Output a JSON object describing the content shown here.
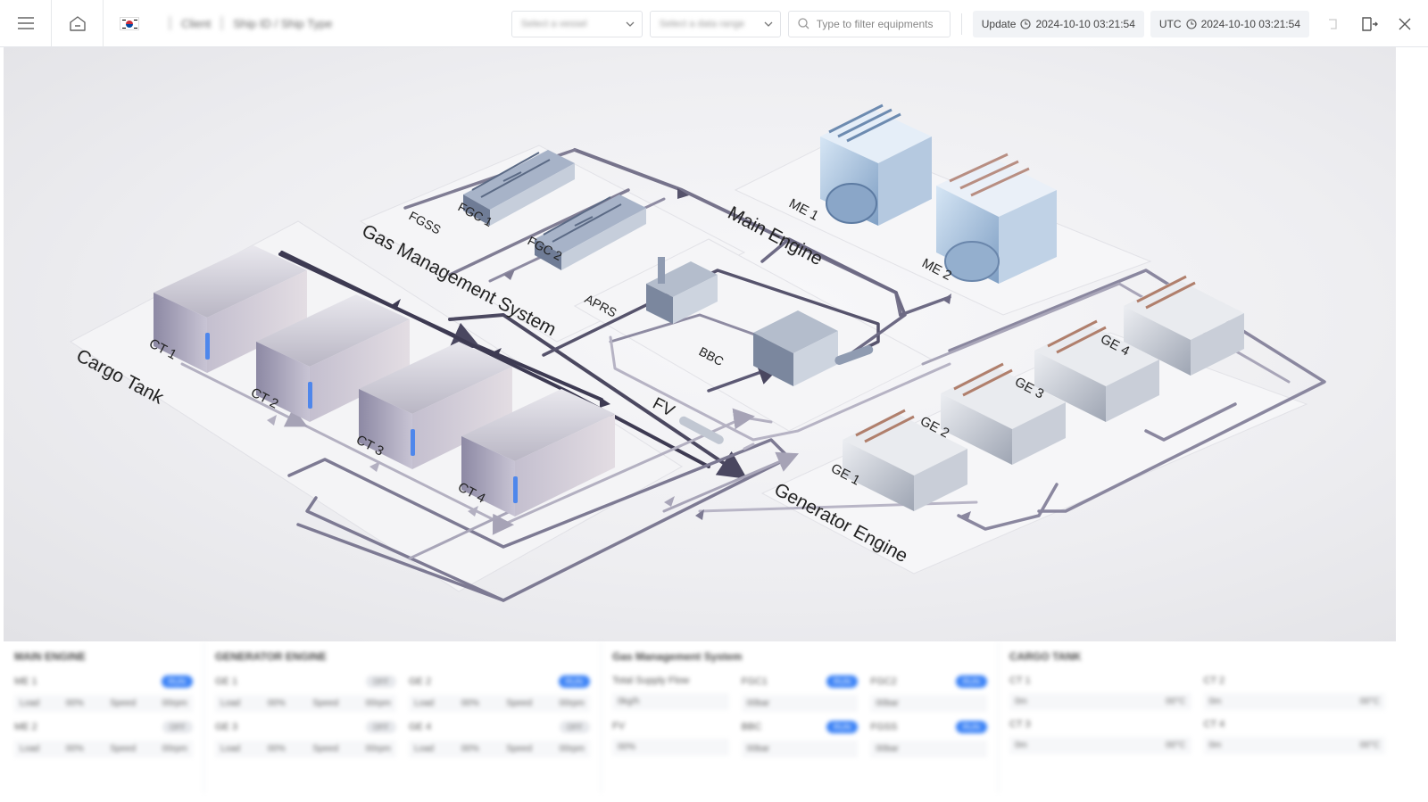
{
  "header": {
    "menu_icon": "hamburger-icon",
    "home_icon": "home-icon",
    "flag": "korea-flag",
    "breadcrumb_1": "Client",
    "breadcrumb_2": "Ship ID / Ship Type",
    "select_vessel_placeholder": "Select a vessel",
    "select_date_placeholder": "Select a data range",
    "filter_placeholder": "Type to filter equipments",
    "update_label": "Update",
    "update_time": "2024-10-10 03:21:54",
    "utc_label": "UTC",
    "utc_time": "2024-10-10 03:21:54"
  },
  "diagram": {
    "labels": {
      "cargo_tank": "Cargo Tank",
      "ct1": "CT 1",
      "ct2": "CT 2",
      "ct3": "CT 3",
      "ct4": "CT 4",
      "gms": "Gas Management System",
      "fgss": "FGSS",
      "fgc1": "FGC 1",
      "fgc2": "FGC 2",
      "aprs": "APRS",
      "bbc": "BBC",
      "fv": "FV",
      "main_engine": "Main Engine",
      "me1": "ME 1",
      "me2": "ME 2",
      "generator_engine": "Generator Engine",
      "ge1": "GE 1",
      "ge2": "GE 2",
      "ge3": "GE 3",
      "ge4": "GE 4"
    }
  },
  "panel": {
    "main_engine": {
      "title": "MAIN ENGINE",
      "units": [
        {
          "name": "ME 1",
          "status": "RUN",
          "load_label": "Load",
          "load": "00%",
          "speed_label": "Speed",
          "speed": "00rpm"
        },
        {
          "name": "ME 2",
          "status": "OFF",
          "load_label": "Load",
          "load": "00%",
          "speed_label": "Speed",
          "speed": "00rpm"
        }
      ]
    },
    "generator_engine": {
      "title": "GENERATOR ENGINE",
      "units": [
        {
          "name": "GE 1",
          "status": "OFF",
          "load_label": "Load",
          "load": "00%",
          "speed_label": "Speed",
          "speed": "00rpm"
        },
        {
          "name": "GE 2",
          "status": "RUN",
          "load_label": "Load",
          "load": "00%",
          "speed_label": "Speed",
          "speed": "00rpm"
        },
        {
          "name": "GE 3",
          "status": "OFF",
          "load_label": "Load",
          "load": "00%",
          "speed_label": "Speed",
          "speed": "00rpm"
        },
        {
          "name": "GE 4",
          "status": "OFF",
          "load_label": "Load",
          "load": "00%",
          "speed_label": "Speed",
          "speed": "00rpm"
        }
      ]
    },
    "gms": {
      "title": "Gas Management System",
      "total_supply_label": "Total Supply Flow",
      "total_supply": "0kg/h",
      "fv_label": "FV",
      "fv_value": "00%",
      "units": [
        {
          "name": "FGC1",
          "status": "RUN",
          "value": "00bar"
        },
        {
          "name": "FGC2",
          "status": "RUN",
          "value": "00bar"
        },
        {
          "name": "BBC",
          "status": "RUN",
          "value": "00bar"
        },
        {
          "name": "FGSS",
          "status": "RUN",
          "value": "00bar"
        }
      ]
    },
    "cargo_tank": {
      "title": "CARGO TANK",
      "units": [
        {
          "name": "CT 1",
          "level": "0m",
          "temp": "00°C"
        },
        {
          "name": "CT 2",
          "level": "0m",
          "temp": "00°C"
        },
        {
          "name": "CT 3",
          "level": "0m",
          "temp": "00°C"
        },
        {
          "name": "CT 4",
          "level": "0m",
          "temp": "00°C"
        }
      ]
    }
  }
}
